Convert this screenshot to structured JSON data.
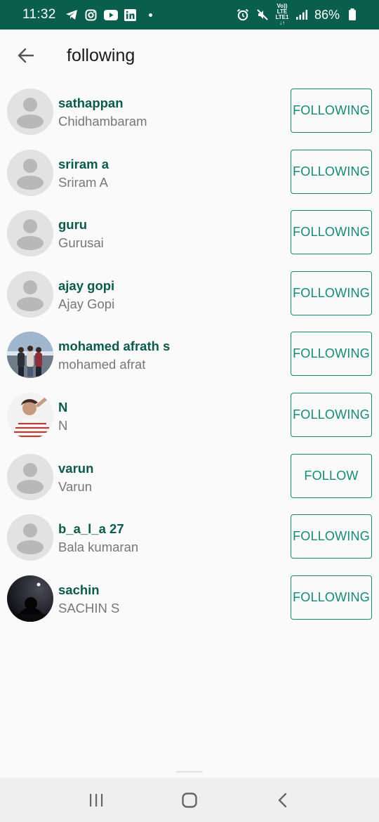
{
  "status_bar": {
    "time": "11:32",
    "battery": "86%",
    "network": "LTE"
  },
  "header": {
    "title": "following",
    "back_icon": "arrow-back-icon"
  },
  "users": [
    {
      "name": "sathappan",
      "subtitle": "Chidhambaram",
      "button": "FOLLOWING",
      "avatar": "default"
    },
    {
      "name": "sriram a",
      "subtitle": "Sriram A",
      "button": "FOLLOWING",
      "avatar": "default"
    },
    {
      "name": "guru",
      "subtitle": "Gurusai",
      "button": "FOLLOWING",
      "avatar": "default"
    },
    {
      "name": "ajay gopi",
      "subtitle": "Ajay Gopi",
      "button": "FOLLOWING",
      "avatar": "default"
    },
    {
      "name": "mohamed afrath s",
      "subtitle": "mohamed afrat",
      "button": "FOLLOWING",
      "avatar": "photo-group"
    },
    {
      "name": "N",
      "subtitle": "N",
      "button": "FOLLOWING",
      "avatar": "photo-person"
    },
    {
      "name": "varun",
      "subtitle": "Varun",
      "button": "FOLLOW",
      "avatar": "default"
    },
    {
      "name": "b_a_l_a 27",
      "subtitle": "Bala kumaran",
      "button": "FOLLOWING",
      "avatar": "default"
    },
    {
      "name": "sachin",
      "subtitle": "SACHIN S",
      "button": "FOLLOWING",
      "avatar": "photo-night"
    }
  ],
  "colors": {
    "status_bar": "#0a5e4e",
    "name_text": "#0b5a4c",
    "accent": "#148a74"
  }
}
